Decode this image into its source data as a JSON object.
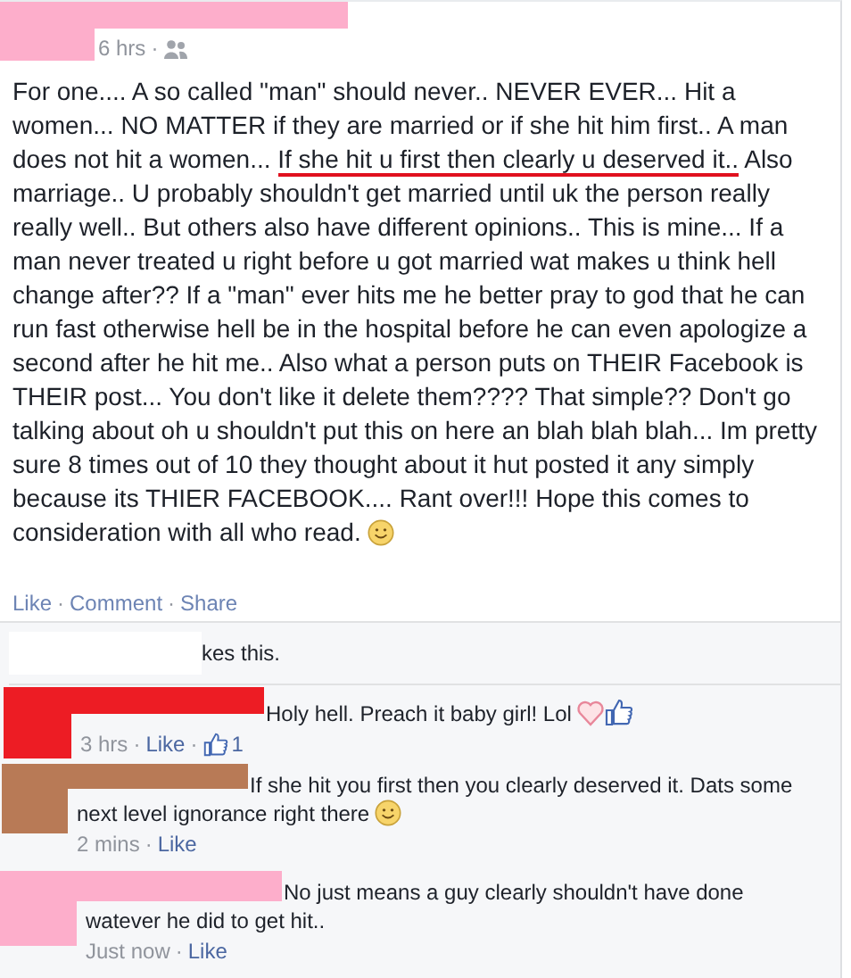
{
  "post": {
    "color": "#fdaecb",
    "meta": [
      {
        "kind": "text",
        "text": "6 hrs"
      },
      {
        "kind": "separator",
        "text": "·"
      },
      {
        "kind": "audience"
      }
    ],
    "body": [
      {
        "text": "For one.... A so called \"man\" should never.. NEVER EVER... Hit a women... NO MATTER if they are married or if she hit him first.. A man does not hit a women... ",
        "underlined": false
      },
      {
        "text": "If she hit u first then clearly u deserved it..",
        "underlined": true
      },
      {
        "text": " Also marriage.. U probably shouldn't get married until uk the person really really well.. But others also have different opinions.. This is mine... If a man never treated u right before u got married wat makes u think hell change after?? If a \"man\" ever hits me he better pray to god that he can run fast otherwise hell be in the hospital before he can even apologize a second after he hit me.. Also what a person puts on THEIR Facebook is THEIR post... You don't like it delete them???? That simple?? Don't go talking about oh u shouldn't put this on here an blah blah blah... Im pretty sure 8 times out of 10 they thought about it hut posted it any simply because its THIER FACEBOOK.... Rant over!!! Hope this comes to consideration with all who read. ",
        "underlined": false
      }
    ],
    "emoticons": [
      {
        "kind": "smile"
      }
    ],
    "actions": [
      {
        "kind": "link",
        "text": "Like"
      },
      {
        "kind": "separator",
        "text": "·"
      },
      {
        "kind": "link",
        "text": "Comment"
      },
      {
        "kind": "separator",
        "text": "·"
      },
      {
        "kind": "link",
        "text": "Share"
      }
    ]
  },
  "likes": {
    "color": "#ffffff",
    "text": "kes this."
  },
  "comments": [
    {
      "color": "#ed1c24",
      "text": "Holy hell. Preach it baby girl! Lol",
      "emoticons": [
        {
          "kind": "heart"
        },
        {
          "kind": "like"
        }
      ],
      "meta": [
        {
          "kind": "text",
          "text": "3 hrs"
        },
        {
          "kind": "separator",
          "text": "·"
        },
        {
          "kind": "link",
          "text": "Like"
        },
        {
          "kind": "separator",
          "text": "·"
        },
        {
          "kind": "count",
          "text": "1"
        }
      ]
    },
    {
      "color": "#b87a56",
      "text": "If she hit you first then you clearly deserved it. Dats some next level ignorance right there ",
      "emoticons": [
        {
          "kind": "smile"
        }
      ],
      "meta": [
        {
          "kind": "text",
          "text": "2 mins"
        },
        {
          "kind": "separator",
          "text": "·"
        },
        {
          "kind": "link",
          "text": "Like"
        }
      ]
    },
    {
      "color": "#fdaecb",
      "text": "No just means a guy clearly shouldn't have done watever he did to get hit..",
      "meta": [
        {
          "kind": "text",
          "text": "Just now"
        },
        {
          "kind": "separator",
          "text": "·"
        },
        {
          "kind": "link",
          "text": "Like"
        }
      ]
    }
  ]
}
